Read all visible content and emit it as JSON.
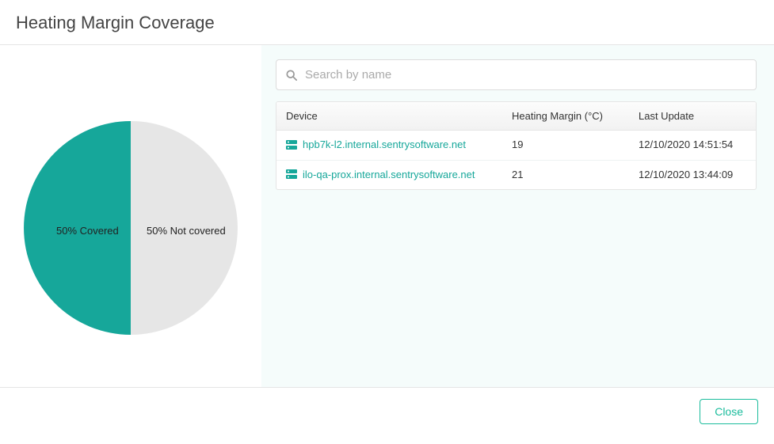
{
  "header": {
    "title": "Heating Margin Coverage"
  },
  "search": {
    "placeholder": "Search by name"
  },
  "columns": {
    "device": "Device",
    "margin": "Heating Margin (°C)",
    "update": "Last Update"
  },
  "rows": [
    {
      "device": "hpb7k-l2.internal.sentrysoftware.net",
      "margin": "19",
      "update": "12/10/2020 14:51:54"
    },
    {
      "device": "ilo-qa-prox.internal.sentrysoftware.net",
      "margin": "21",
      "update": "12/10/2020 13:44:09"
    }
  ],
  "chart_data": {
    "type": "pie",
    "title": "",
    "series": [
      {
        "name": "Covered",
        "value": 50,
        "label": "50% Covered",
        "color": "#16a79a"
      },
      {
        "name": "Not covered",
        "value": 50,
        "label": "50% Not covered",
        "color": "#e6e6e6"
      }
    ]
  },
  "footer": {
    "close": "Close"
  }
}
